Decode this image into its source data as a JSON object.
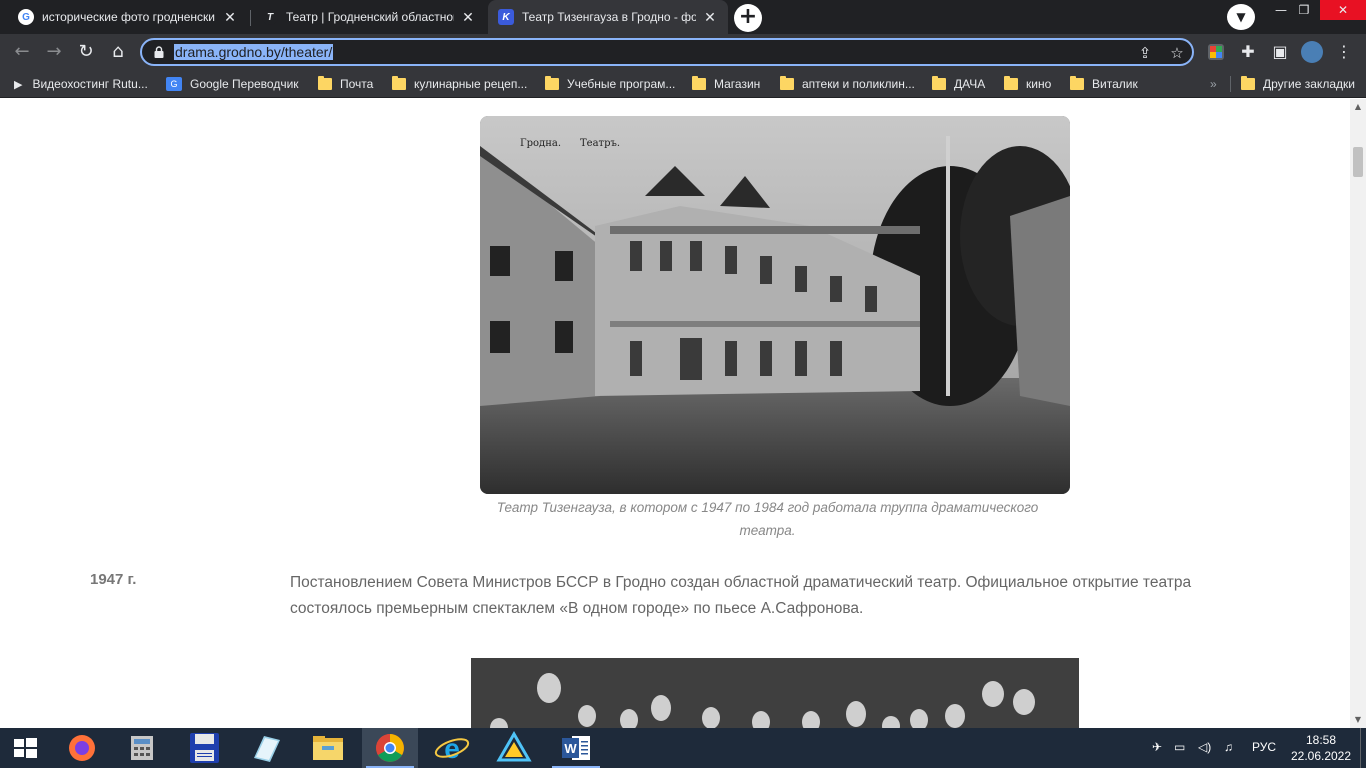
{
  "tabs": [
    {
      "title": "исторические фото гродненски",
      "active": false,
      "favicon": "google-icon"
    },
    {
      "title": "Театр | Гродненский областной",
      "active": false,
      "favicon": "theater-site-icon"
    },
    {
      "title": "Театр Тизенгауза в Гродно - фот",
      "active": true,
      "favicon": "site-k-icon"
    }
  ],
  "toolbar": {
    "url": "drama.grodno.by/theater/"
  },
  "bookmarks": [
    {
      "label": "Видеохостинг Rutu...",
      "icon": "play-icon"
    },
    {
      "label": "Google Переводчик",
      "icon": "translate-icon"
    },
    {
      "label": "Почта",
      "icon": "folder-icon"
    },
    {
      "label": "кулинарные рецеп...",
      "icon": "folder-icon"
    },
    {
      "label": "Учебные програм...",
      "icon": "folder-icon"
    },
    {
      "label": "Магазин",
      "icon": "folder-icon"
    },
    {
      "label": "аптеки и поликлин...",
      "icon": "folder-icon"
    },
    {
      "label": "ДАЧА",
      "icon": "folder-icon"
    },
    {
      "label": "кино",
      "icon": "folder-icon"
    },
    {
      "label": "Виталик",
      "icon": "folder-icon"
    }
  ],
  "other_bookmarks": "Другие закладки",
  "content": {
    "photo1_caption": "Театр Тизенгауза, в котором с 1947 по 1984 год работала труппа драматического театра.",
    "photo1_text_left": "Гродна.",
    "photo1_text_right": "Театръ.",
    "year": "1947 г.",
    "paragraph": "Постановлением Совета Министров БССР в Гродно создан областной драматический театр. Официальное открытие театра состоялось премьерным спектаклем «В одном городе» по пьесе А.Сафронова."
  },
  "taskbar": {
    "apps": [
      "windows-start-icon",
      "firefox-icon",
      "calculator-icon",
      "save-disk-icon",
      "notepad-icon",
      "file-explorer-icon",
      "chrome-icon",
      "internet-explorer-icon",
      "triangle-app-icon",
      "word-icon"
    ],
    "language": "РУС",
    "time": "18:58",
    "date": "22.06.2022"
  },
  "colors": {
    "accent": "#8ab4f8",
    "chrome_dark": "#202124",
    "chrome_mid": "#35363a"
  }
}
